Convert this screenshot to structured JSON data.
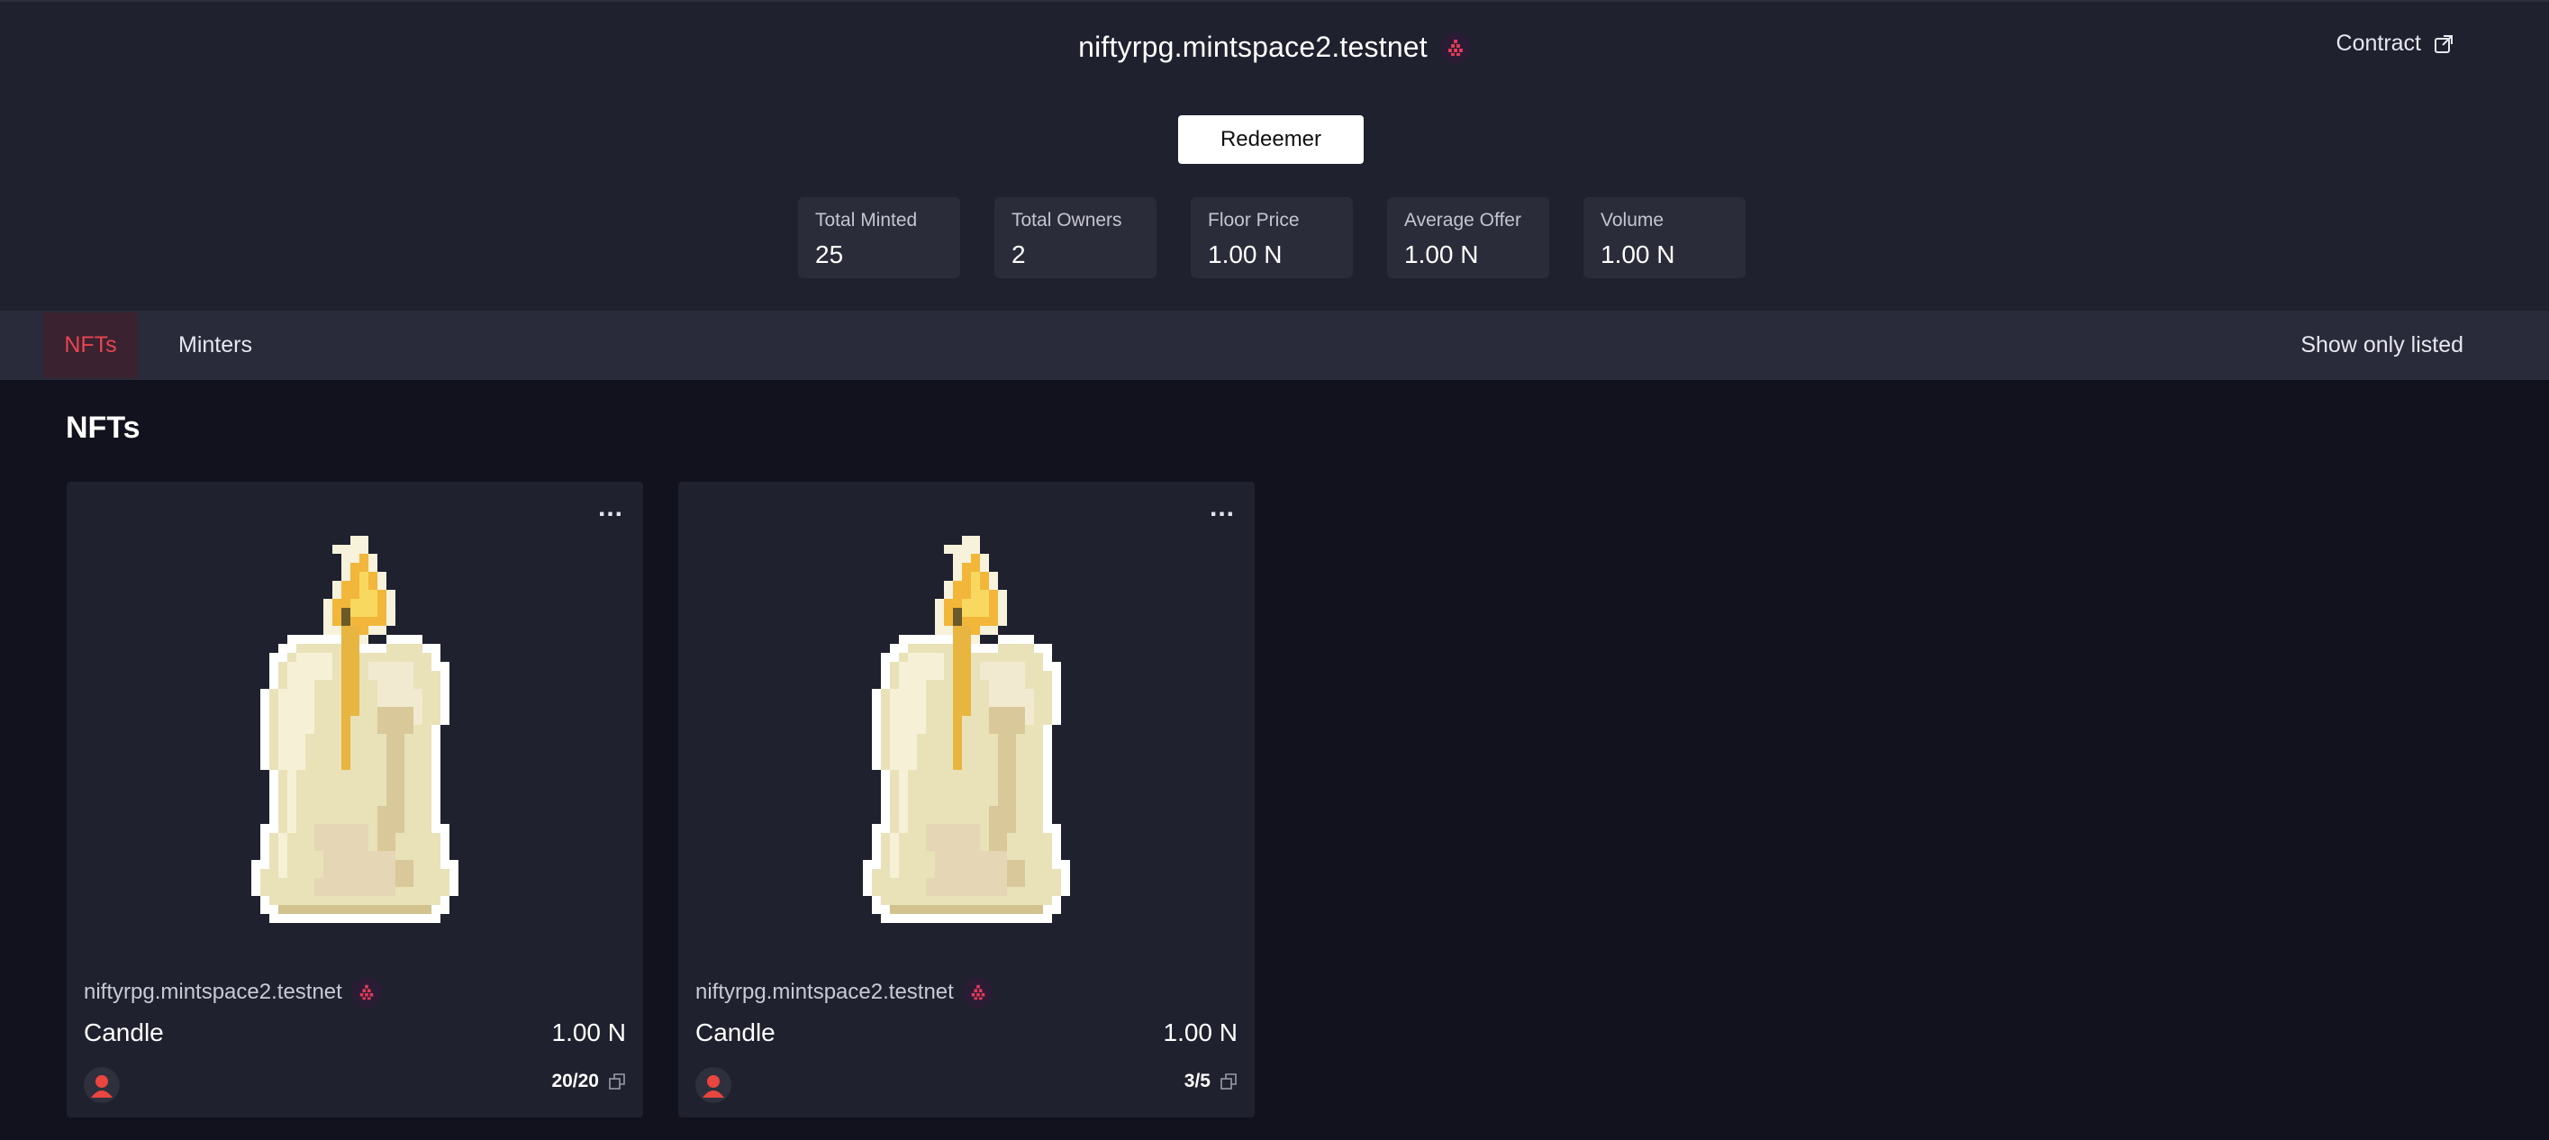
{
  "header": {
    "store_name": "niftyrpg.mintspace2.testnet",
    "contract_label": "Contract",
    "redeemer_label": "Redeemer",
    "stats": [
      {
        "label": "Total Minted",
        "value": "25"
      },
      {
        "label": "Total Owners",
        "value": "2"
      },
      {
        "label": "Floor Price",
        "value": "1.00 N"
      },
      {
        "label": "Average Offer",
        "value": "1.00 N"
      },
      {
        "label": "Volume",
        "value": "1.00 N"
      }
    ]
  },
  "tabs": {
    "items": [
      {
        "label": "NFTs",
        "active": true
      },
      {
        "label": "Minters",
        "active": false
      }
    ],
    "filter_label": "Show only listed"
  },
  "main": {
    "section_title": "NFTs",
    "cards": [
      {
        "owner": "niftyrpg.mintspace2.testnet",
        "name": "Candle",
        "price": "1.00 N",
        "editions": "20/20",
        "menu": "...",
        "image": "candle-icon"
      },
      {
        "owner": "niftyrpg.mintspace2.testnet",
        "name": "Candle",
        "price": "1.00 N",
        "editions": "3/5",
        "menu": "...",
        "image": "candle-icon"
      }
    ]
  },
  "colors": {
    "accent": "#e7454f",
    "header_bg": "#1f212f",
    "page_bg": "#11121e",
    "tabbar_bg": "#292b3a"
  }
}
